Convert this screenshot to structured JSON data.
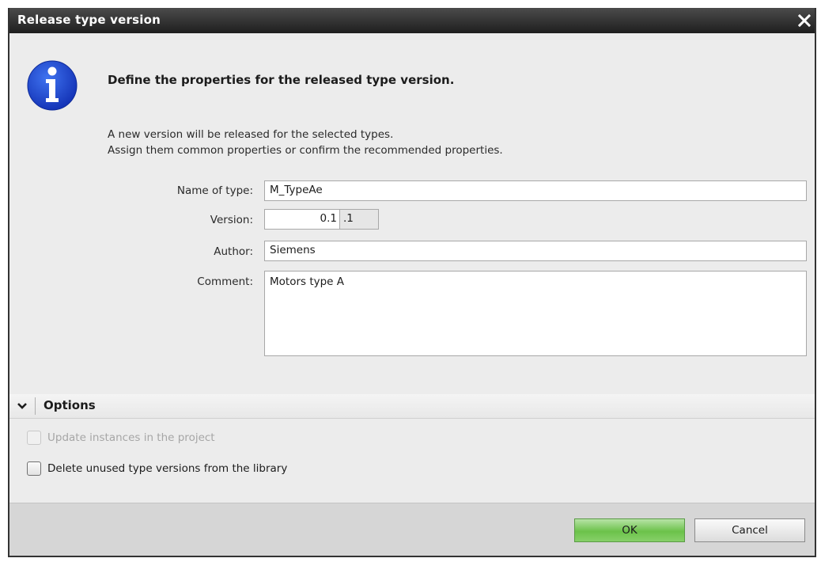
{
  "dialog": {
    "title": "Release type version",
    "headline": "Define the properties for the released type version.",
    "description_line1": "A new version will be released for the selected types.",
    "description_line2": "Assign them common properties or confirm the recommended properties."
  },
  "form": {
    "name_label": "Name of type:",
    "name_value": "M_TypeAe",
    "version_label": "Version:",
    "version_major": "0.1",
    "version_minor": ".1",
    "author_label": "Author:",
    "author_value": "Siemens",
    "comment_label": "Comment:",
    "comment_value": "Motors type A"
  },
  "options": {
    "header": "Options",
    "update_instances": {
      "label": "Update instances in the project",
      "checked": false,
      "enabled": false
    },
    "delete_unused": {
      "label": "Delete unused type versions from the library",
      "checked": false,
      "enabled": true
    }
  },
  "buttons": {
    "ok": "OK",
    "cancel": "Cancel"
  },
  "colors": {
    "titlebar": "#2a2a2a",
    "info_icon": "#1f4fd6",
    "ok_button": "#6cc24a"
  },
  "icons": {
    "close": "close-icon",
    "info": "info-icon",
    "chevron": "chevron-down-icon"
  }
}
